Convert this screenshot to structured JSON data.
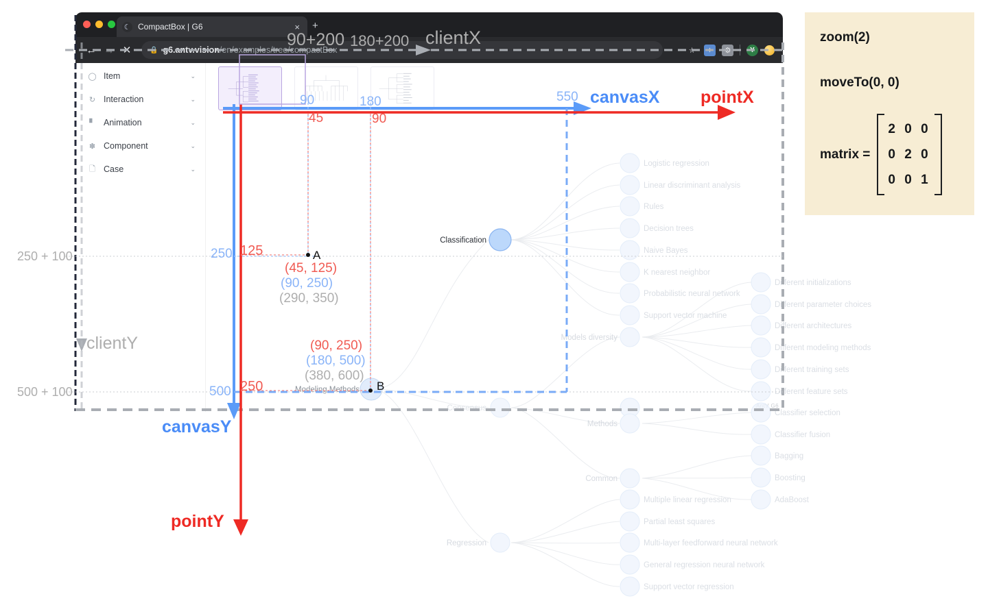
{
  "browser": {
    "tab_title": "CompactBox | G6",
    "tab_favicon": "moon-icon",
    "new_tab_label": "+",
    "close_tab_label": "×",
    "back_label": "←",
    "forward_label": "→",
    "stop_label": "✕",
    "lock_label": "🔒",
    "url_bold": "g6.antv.vision",
    "url_rest": "/en/examples/tree/compactBox",
    "star_label": "☆",
    "avatar_letter": "Y"
  },
  "sidebar": {
    "items": [
      {
        "label": "Item",
        "icon": "shape-icon",
        "chevron": "⌄"
      },
      {
        "label": "Interaction",
        "icon": "refresh-icon",
        "chevron": "⌄"
      },
      {
        "label": "Animation",
        "icon": "chart-icon",
        "chevron": "⌄"
      },
      {
        "label": "Component",
        "icon": "wand-icon",
        "chevron": "⌄"
      },
      {
        "label": "Case",
        "icon": "file-icon",
        "chevron": "⌄"
      }
    ]
  },
  "canvas": {
    "watermark": "AntV G6",
    "thumbnails": [
      {
        "name": "compact-box-tree",
        "selected": true
      },
      {
        "name": "dendrogram-tree",
        "selected": false
      },
      {
        "name": "mindmap-tree",
        "selected": false
      }
    ]
  },
  "infobox": {
    "zoom_line": "zoom(2)",
    "moveto_line": "moveTo(0, 0)",
    "matrix_label": "matrix =",
    "matrix_rows": [
      "2 0 0",
      "0 2 0",
      "0 0 1"
    ],
    "background": "#f7edd4"
  },
  "annotations": {
    "axis_labels": {
      "clientX": "clientX",
      "clientY": "clientY",
      "canvasX": "canvasX",
      "canvasY": "canvasY",
      "pointX": "pointX",
      "pointY": "pointY"
    },
    "top_client_ticks": [
      "90+200",
      "180+200"
    ],
    "top_canvas_ticks": [
      "90",
      "180"
    ],
    "top_point_ticks": [
      "45",
      "90"
    ],
    "canvas_x_end": "550",
    "left_client_ticks": [
      "250 + 100",
      "500 + 100"
    ],
    "left_canvas_ticks": [
      "250",
      "500"
    ],
    "left_point_ticks": [
      "125",
      "250"
    ],
    "points": [
      {
        "id": "A",
        "label": "A",
        "point": "(45, 125)",
        "canvas": "(90, 250)",
        "client": "(290, 350)"
      },
      {
        "id": "B",
        "label": "B",
        "point": "(90, 250)",
        "canvas": "(180, 500)",
        "client": "(380, 600)"
      }
    ],
    "colors": {
      "point_axis": "#ee2a24",
      "canvas_axis": "#4a8cf7",
      "client_axis": "#9a9a9a"
    }
  },
  "chart_data": {
    "type": "tree",
    "title": "Modeling Methods",
    "root": "Modeling Methods",
    "branches": [
      {
        "name": "Classification",
        "children": [
          "Logistic regression",
          "Linear discriminant analysis",
          "Rules",
          "Decision trees",
          "Naive Bayes",
          "K nearest neighbor",
          "Probabilistic neural network",
          "Support vector machine"
        ]
      },
      {
        "name": "Consensus",
        "children": [
          {
            "name": "Models diversity",
            "children": [
              "Different initializations",
              "Different parameter choices",
              "Different architectures",
              "Different modeling methods",
              "Different training sets",
              "Different feature sets"
            ]
          },
          {
            "name": "Methods",
            "children": [
              "Classifier selection",
              "Classifier fusion"
            ]
          },
          {
            "name": "Common",
            "children": [
              "Bagging",
              "Boosting",
              "AdaBoost"
            ]
          }
        ]
      },
      {
        "name": "Regression",
        "children": [
          "Multiple linear regression",
          "Partial least squares",
          "Multi-layer feedforward neural network",
          "General regression neural network",
          "Support vector regression"
        ]
      }
    ]
  }
}
